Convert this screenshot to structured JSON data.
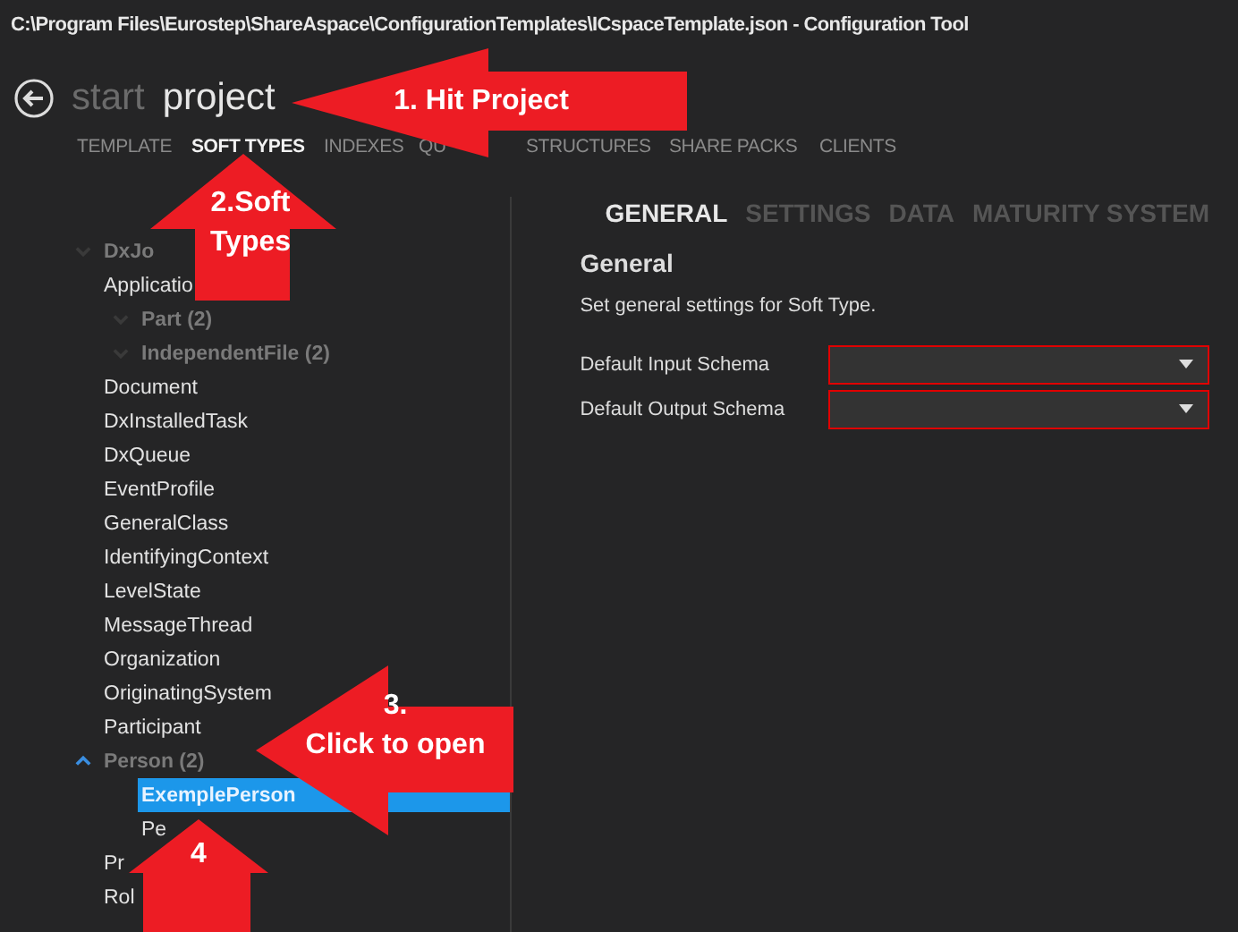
{
  "window": {
    "title": "C:\\Program Files\\Eurostep\\ShareAspace\\ConfigurationTemplates\\ICspaceTemplate.json - Configuration Tool"
  },
  "breadcrumb": [
    {
      "label": "start",
      "selected": false
    },
    {
      "label": "project",
      "selected": true
    }
  ],
  "nav": [
    {
      "label": "TEMPLATE",
      "selected": false
    },
    {
      "label": "SOFT TYPES",
      "selected": true
    },
    {
      "label": "INDEXES",
      "selected": false
    },
    {
      "label": "QU",
      "selected": false
    },
    {
      "label": "STRUCTURES",
      "selected": false
    },
    {
      "label": "SHARE PACKS",
      "selected": false
    },
    {
      "label": "CLIENTS",
      "selected": false
    }
  ],
  "tree": [
    {
      "label": "DxJo",
      "disabled": true,
      "expanded": false,
      "selected": false
    },
    {
      "label": "Applicatio",
      "disabled": false,
      "selected": false,
      "children": [
        {
          "label": "Part (2)",
          "disabled": true,
          "expanded": false,
          "selected": false
        },
        {
          "label": "IndependentFile (2)",
          "disabled": true,
          "expanded": false,
          "selected": false
        }
      ]
    },
    {
      "label": "Document",
      "disabled": false,
      "selected": false
    },
    {
      "label": "DxInstalledTask",
      "disabled": false,
      "selected": false
    },
    {
      "label": "DxQueue",
      "disabled": false,
      "selected": false
    },
    {
      "label": "EventProfile",
      "disabled": false,
      "selected": false
    },
    {
      "label": "GeneralClass",
      "disabled": false,
      "selected": false
    },
    {
      "label": "IdentifyingContext",
      "disabled": false,
      "selected": false
    },
    {
      "label": "LevelState",
      "disabled": false,
      "selected": false
    },
    {
      "label": "MessageThread",
      "disabled": false,
      "selected": false
    },
    {
      "label": "Organization",
      "disabled": false,
      "selected": false
    },
    {
      "label": "OriginatingSystem",
      "disabled": false,
      "selected": false
    },
    {
      "label": "Participant",
      "disabled": false,
      "selected": false
    },
    {
      "label": "Person (2)",
      "disabled": true,
      "expanded": true,
      "selected": false,
      "children": [
        {
          "label": "ExemplePerson",
          "disabled": false,
          "selected": true
        },
        {
          "label": "Pe",
          "disabled": false,
          "selected": false
        }
      ]
    },
    {
      "label": "Pr",
      "disabled": false,
      "selected": false
    },
    {
      "label": "Rol",
      "disabled": false,
      "selected": false
    }
  ],
  "detail_tabs": [
    {
      "label": "GENERAL",
      "selected": true
    },
    {
      "label": "SETTINGS",
      "selected": false
    },
    {
      "label": "DATA",
      "selected": false
    },
    {
      "label": "MATURITY SYSTEM",
      "selected": false
    }
  ],
  "section": {
    "title": "General",
    "description": "Set general settings for Soft Type."
  },
  "fields": [
    {
      "label": "Default Input Schema",
      "invalid": true
    },
    {
      "label": "Default Output Schema",
      "invalid": true
    }
  ],
  "annotations": [
    {
      "kind": "left",
      "label": "1. Hit Project"
    },
    {
      "kind": "up",
      "label": "2.Soft\nTypes"
    },
    {
      "kind": "left",
      "label": "3.\nClick to open"
    },
    {
      "kind": "up",
      "label": "4"
    }
  ]
}
